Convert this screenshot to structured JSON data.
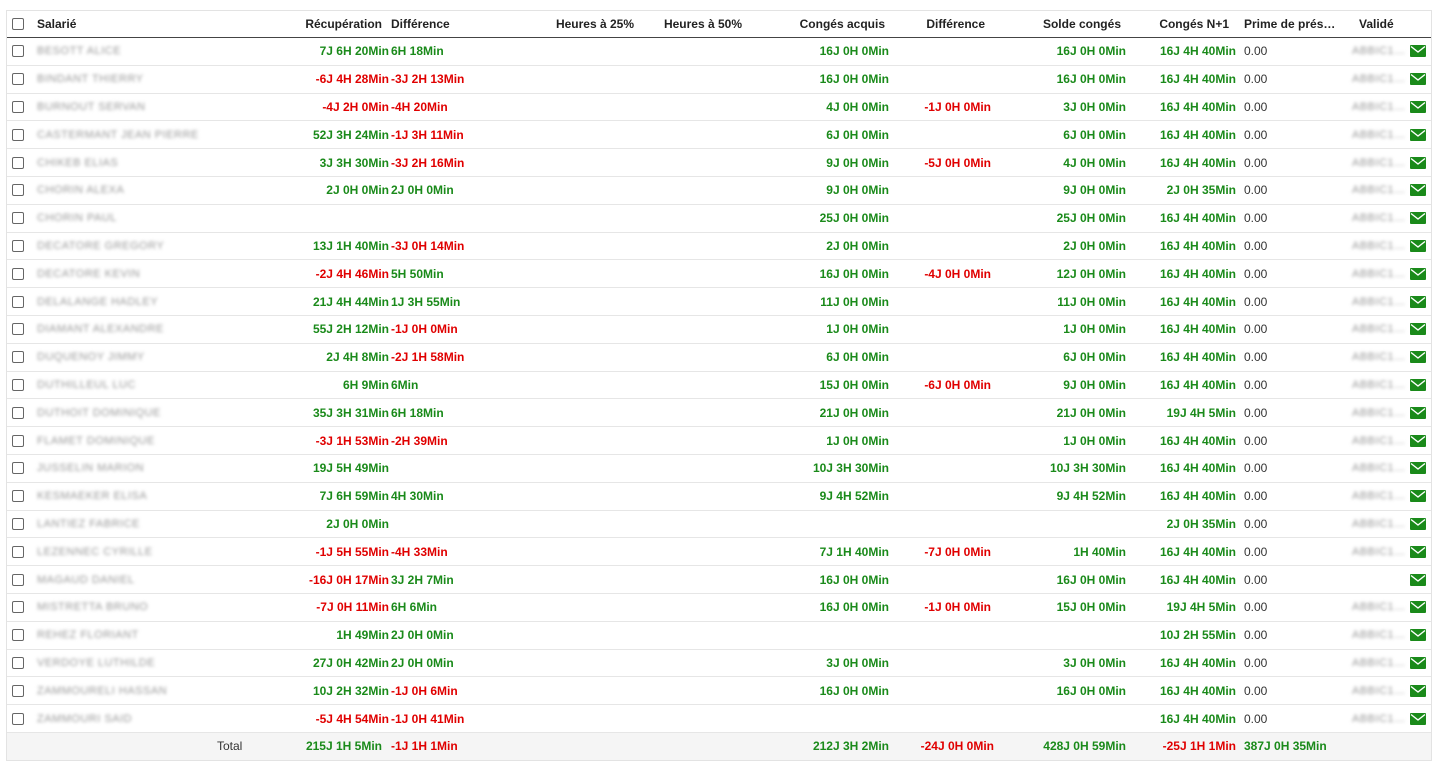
{
  "headers": {
    "salarie": "Salarié",
    "recuperation": "Récupération",
    "difference1": "Différence",
    "heures25": "Heures à 25%",
    "heures50": "Heures à 50%",
    "conges_acquis": "Congés acquis",
    "difference2": "Différence",
    "solde_conges": "Solde congés",
    "conges_n1": "Congés N+1",
    "prime": "Prime de prés…",
    "valide": "Validé"
  },
  "colors": {
    "positive": "#1a8a1a",
    "negative": "#e00000",
    "mail_icon": "#1a8a1a"
  },
  "rows": [
    {
      "name": "BESOTT ALICE",
      "recup": "7J 6H 20Min",
      "diff1": "6H 18Min",
      "acquis": "16J 0H 0Min",
      "diff2": "",
      "solde": "16J 0H 0Min",
      "n1": "16J 4H 40Min",
      "prime": "0.00",
      "valide": "ABBIC1…",
      "icon": "envelope-icon"
    },
    {
      "name": "BINDANT THIERRY",
      "recup": "-6J 4H 28Min",
      "diff1": "-3J 2H 13Min",
      "acquis": "16J 0H 0Min",
      "diff2": "",
      "solde": "16J 0H 0Min",
      "n1": "16J 4H 40Min",
      "prime": "0.00",
      "valide": "ABBIC1…",
      "icon": "envelope-icon"
    },
    {
      "name": "BURNOUT SERVAN",
      "recup": "-4J 2H 0Min",
      "diff1": "-4H 20Min",
      "acquis": "4J 0H 0Min",
      "diff2": "-1J 0H 0Min",
      "solde": "3J 0H 0Min",
      "n1": "16J 4H 40Min",
      "prime": "0.00",
      "valide": "ABBIC1…",
      "icon": "envelope-icon"
    },
    {
      "name": "CASTERMANT JEAN PIERRE",
      "recup": "52J 3H 24Min",
      "diff1": "-1J 3H 11Min",
      "acquis": "6J 0H 0Min",
      "diff2": "",
      "solde": "6J 0H 0Min",
      "n1": "16J 4H 40Min",
      "prime": "0.00",
      "valide": "ABBIC1…",
      "icon": "envelope-icon"
    },
    {
      "name": "CHIKEB ELIAS",
      "recup": "3J 3H 30Min",
      "diff1": "-3J 2H 16Min",
      "acquis": "9J 0H 0Min",
      "diff2": "-5J 0H 0Min",
      "solde": "4J 0H 0Min",
      "n1": "16J 4H 40Min",
      "prime": "0.00",
      "valide": "ABBIC1…",
      "icon": "envelope-icon"
    },
    {
      "name": "CHORIN ALEXA",
      "recup": "2J 0H 0Min",
      "diff1": "2J 0H 0Min",
      "acquis": "9J 0H 0Min",
      "diff2": "",
      "solde": "9J 0H 0Min",
      "n1": "2J 0H 35Min",
      "prime": "0.00",
      "valide": "ABBIC1…",
      "icon": "envelope-icon"
    },
    {
      "name": "CHORIN PAUL",
      "recup": "",
      "diff1": "",
      "acquis": "25J 0H 0Min",
      "diff2": "",
      "solde": "25J 0H 0Min",
      "n1": "16J 4H 40Min",
      "prime": "0.00",
      "valide": "ABBIC1…",
      "icon": "envelope-icon"
    },
    {
      "name": "DECATORE GREGORY",
      "recup": "13J 1H 40Min",
      "diff1": "-3J 0H 14Min",
      "acquis": "2J 0H 0Min",
      "diff2": "",
      "solde": "2J 0H 0Min",
      "n1": "16J 4H 40Min",
      "prime": "0.00",
      "valide": "ABBIC1…",
      "icon": "envelope-icon"
    },
    {
      "name": "DECATORE KEVIN",
      "recup": "-2J 4H 46Min",
      "diff1": "5H 50Min",
      "acquis": "16J 0H 0Min",
      "diff2": "-4J 0H 0Min",
      "solde": "12J 0H 0Min",
      "n1": "16J 4H 40Min",
      "prime": "0.00",
      "valide": "ABBIC1…",
      "icon": "envelope-icon"
    },
    {
      "name": "DELALANGE HADLEY",
      "recup": "21J 4H 44Min",
      "diff1": "1J 3H 55Min",
      "acquis": "11J 0H 0Min",
      "diff2": "",
      "solde": "11J 0H 0Min",
      "n1": "16J 4H 40Min",
      "prime": "0.00",
      "valide": "ABBIC1…",
      "icon": "envelope-icon"
    },
    {
      "name": "DIAMANT ALEXANDRE",
      "recup": "55J 2H 12Min",
      "diff1": "-1J 0H 0Min",
      "acquis": "1J 0H 0Min",
      "diff2": "",
      "solde": "1J 0H 0Min",
      "n1": "16J 4H 40Min",
      "prime": "0.00",
      "valide": "ABBIC1…",
      "icon": "envelope-icon"
    },
    {
      "name": "DUQUENOY JIMMY",
      "recup": "2J 4H 8Min",
      "diff1": "-2J 1H 58Min",
      "acquis": "6J 0H 0Min",
      "diff2": "",
      "solde": "6J 0H 0Min",
      "n1": "16J 4H 40Min",
      "prime": "0.00",
      "valide": "ABBIC1…",
      "icon": "envelope-icon"
    },
    {
      "name": "DUTHILLEUL LUC",
      "recup": "6H 9Min",
      "diff1": "6Min",
      "acquis": "15J 0H 0Min",
      "diff2": "-6J 0H 0Min",
      "solde": "9J 0H 0Min",
      "n1": "16J 4H 40Min",
      "prime": "0.00",
      "valide": "ABBIC1…",
      "icon": "envelope-icon"
    },
    {
      "name": "DUTHOIT DOMINIQUE",
      "recup": "35J 3H 31Min",
      "diff1": "6H 18Min",
      "acquis": "21J 0H 0Min",
      "diff2": "",
      "solde": "21J 0H 0Min",
      "n1": "19J 4H 5Min",
      "prime": "0.00",
      "valide": "ABBIC1…",
      "icon": "envelope-icon"
    },
    {
      "name": "FLAMET DOMINIQUE",
      "recup": "-3J 1H 53Min",
      "diff1": "-2H 39Min",
      "acquis": "1J 0H 0Min",
      "diff2": "",
      "solde": "1J 0H 0Min",
      "n1": "16J 4H 40Min",
      "prime": "0.00",
      "valide": "ABBIC1…",
      "icon": "envelope-icon"
    },
    {
      "name": "JUSSELIN MARION",
      "recup": "19J 5H 49Min",
      "diff1": "",
      "acquis": "10J 3H 30Min",
      "diff2": "",
      "solde": "10J 3H 30Min",
      "n1": "16J 4H 40Min",
      "prime": "0.00",
      "valide": "ABBIC1…",
      "icon": "envelope-icon"
    },
    {
      "name": "KESMAEKER ELISA",
      "recup": "7J 6H 59Min",
      "diff1": "4H 30Min",
      "acquis": "9J 4H 52Min",
      "diff2": "",
      "solde": "9J 4H 52Min",
      "n1": "16J 4H 40Min",
      "prime": "0.00",
      "valide": "ABBIC1…",
      "icon": "envelope-icon"
    },
    {
      "name": "LANTIEZ FABRICE",
      "recup": "2J 0H 0Min",
      "diff1": "",
      "acquis": "",
      "diff2": "",
      "solde": "",
      "n1": "2J 0H 35Min",
      "prime": "0.00",
      "valide": "ABBIC1…",
      "icon": "envelope-icon"
    },
    {
      "name": "LEZENNEC CYRILLE",
      "recup": "-1J 5H 55Min",
      "diff1": "-4H 33Min",
      "acquis": "7J 1H 40Min",
      "diff2": "-7J 0H 0Min",
      "solde": "1H 40Min",
      "n1": "16J 4H 40Min",
      "prime": "0.00",
      "valide": "ABBIC1…",
      "icon": "envelope-icon"
    },
    {
      "name": "MAGAUD DANIEL",
      "recup": "-16J 0H 17Min",
      "diff1": "3J 2H 7Min",
      "acquis": "16J 0H 0Min",
      "diff2": "",
      "solde": "16J 0H 0Min",
      "n1": "16J 4H 40Min",
      "prime": "0.00",
      "valide": "",
      "icon": "envelope-icon"
    },
    {
      "name": "MISTRETTA BRUNO",
      "recup": "-7J 0H 11Min",
      "diff1": "6H 6Min",
      "acquis": "16J 0H 0Min",
      "diff2": "-1J 0H 0Min",
      "solde": "15J 0H 0Min",
      "n1": "19J 4H 5Min",
      "prime": "0.00",
      "valide": "ABBIC1…",
      "icon": "envelope-icon"
    },
    {
      "name": "REHEZ FLORIANT",
      "recup": "1H 49Min",
      "diff1": "2J 0H 0Min",
      "acquis": "",
      "diff2": "",
      "solde": "",
      "n1": "10J 2H 55Min",
      "prime": "0.00",
      "valide": "ABBIC1…",
      "icon": "envelope-icon"
    },
    {
      "name": "VERDOYE LUTHILDE",
      "recup": "27J 0H 42Min",
      "diff1": "2J 0H 0Min",
      "acquis": "3J 0H 0Min",
      "diff2": "",
      "solde": "3J 0H 0Min",
      "n1": "16J 4H 40Min",
      "prime": "0.00",
      "valide": "ABBIC1…",
      "icon": "envelope-icon"
    },
    {
      "name": "ZAMMOURELI HASSAN",
      "recup": "10J 2H 32Min",
      "diff1": "-1J 0H 6Min",
      "acquis": "16J 0H 0Min",
      "diff2": "",
      "solde": "16J 0H 0Min",
      "n1": "16J 4H 40Min",
      "prime": "0.00",
      "valide": "ABBIC1…",
      "icon": "envelope-icon"
    },
    {
      "name": "ZAMMOURI SAID",
      "recup": "-5J 4H 54Min",
      "diff1": "-1J 0H 41Min",
      "acquis": "",
      "diff2": "",
      "solde": "",
      "n1": "16J 4H 40Min",
      "prime": "0.00",
      "valide": "ABBIC1…",
      "icon": "envelope-icon"
    }
  ],
  "total": {
    "label": "Total",
    "recup": "215J 1H 5Min",
    "diff1": "-1J 1H 1Min",
    "acquis": "212J 3H 2Min",
    "diff2": "-24J 0H 0Min",
    "solde": "428J 0H 59Min",
    "n1": "-25J 1H 1Min",
    "prime": "387J 0H 35Min"
  }
}
